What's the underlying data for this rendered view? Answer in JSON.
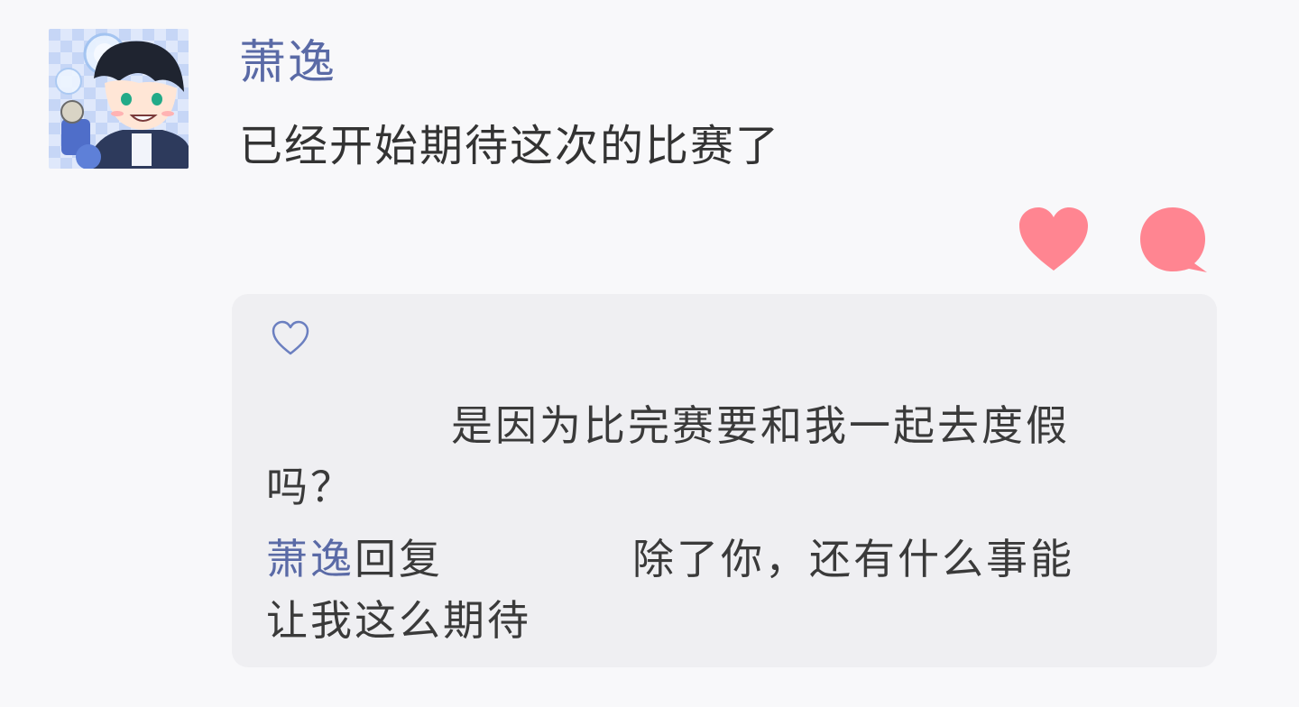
{
  "post": {
    "author_name": "萧逸",
    "text": "已经开始期待这次的比赛了"
  },
  "actions": {
    "like_icon": "heart-icon",
    "comment_icon": "comment-icon",
    "accent_color": "#ff8591"
  },
  "reply_box": {
    "like_icon": "heart-outline-icon",
    "message_line1": "是因为比完赛要和我一起去度假",
    "message_line2": "吗？",
    "reply_author": "萧逸",
    "reply_verb": "回复",
    "reply_line1": "除了你，还有什么事能",
    "reply_line2": "让我这么期待"
  },
  "colors": {
    "name": "#5a6aa6",
    "text": "#333333",
    "box_background": "#efeff2"
  }
}
